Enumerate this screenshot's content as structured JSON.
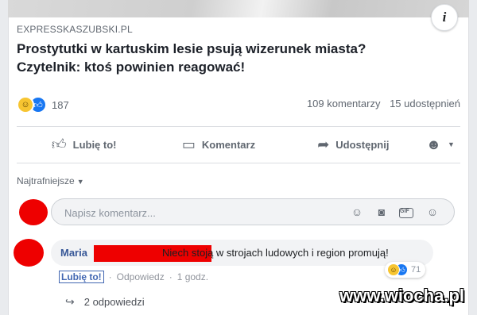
{
  "post": {
    "domain": "EXPRESSKASZUBSKI.PL",
    "headline": "Prostytutki w kartuskim lesie psują wizerunek miasta? Czytelnik: ktoś powinien reagować!",
    "info_icon": "i",
    "reaction_count": "187",
    "comments_count": "109 komentarzy",
    "shares_count": "15 udostępnień"
  },
  "actions": {
    "like": "Lubię to!",
    "comment": "Komentarz",
    "share": "Udostępnij"
  },
  "comments": {
    "sort_label": "Najtrafniejsze",
    "placeholder": "Napisz komentarz...",
    "top_comment": {
      "author": "Maria",
      "text": "Niech stoją w strojach ludowych i region promują!",
      "reaction_count": "71",
      "like_label": "Lubię to!",
      "reply_label": "Odpowiedz",
      "time": "1 godz.",
      "replies_label": "2 odpowiedzi"
    }
  },
  "watermark": "www.wiocha.pl",
  "icons": [
    "info-icon",
    "haha-reaction-icon",
    "like-reaction-icon",
    "thumbs-up-icon",
    "comment-bubble-icon",
    "share-arrow-icon",
    "profile-selector-icon",
    "caret-down-icon",
    "emoji-icon",
    "camera-icon",
    "gif-icon",
    "sticker-icon",
    "reply-arrow-icon"
  ],
  "colors": {
    "link": "#385898",
    "accent": "#1877f2",
    "muted": "#606770",
    "redaction": "#ee0000"
  }
}
